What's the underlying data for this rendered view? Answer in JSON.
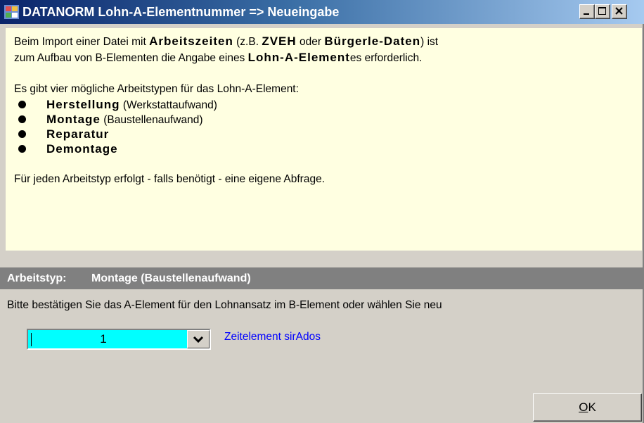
{
  "window": {
    "title": "DATANORM Lohn-A-Elementnummer => Neueingabe",
    "icon": "datanorm-app-icon",
    "controls": [
      "minimize-icon",
      "maximize-icon",
      "close-icon"
    ]
  },
  "info": {
    "para1": {
      "t1": "Beim Import einer Datei mit ",
      "b1": "Arbeitszeiten",
      "t2": " (z.B. ",
      "b2": "ZVEH",
      "t3": " oder ",
      "b3": "Bürgerle-Daten",
      "t4": ") ist",
      "t5": "zum Aufbau von B-Elementen die Angabe eines ",
      "b4": "Lohn-A-Element",
      "t6": "es erforderlich."
    },
    "para2": "Es gibt vier mögliche Arbeitstypen für das Lohn-A-Element:",
    "types": [
      {
        "name": "Herstellung",
        "desc": " (Werkstattaufwand)"
      },
      {
        "name": "Montage",
        "desc": " (Baustellenaufwand)"
      },
      {
        "name": "Reparatur",
        "desc": ""
      },
      {
        "name": "Demontage",
        "desc": ""
      }
    ],
    "para3": "Für jeden Arbeitstyp erfolgt - falls benötigt - eine eigene Abfrage."
  },
  "arbeitstyp": {
    "label": "Arbeitstyp:",
    "value": "Montage (Baustellenaufwand)"
  },
  "instruction": "Bitte bestätigen Sie das A-Element für den Lohnansatz im B-Element oder wählen Sie neu",
  "combo": {
    "value": "1"
  },
  "link": "Zeitelement sirAdos",
  "ok_button": {
    "mnemonic": "O",
    "rest": "K"
  },
  "colors": {
    "title_gradient_start": "#0a246a",
    "title_gradient_end": "#a6caf0",
    "info_background": "#ffffe1",
    "type_bar": "#808080",
    "combo_background": "#00ffff",
    "link": "#0000ff",
    "dialog_background": "#d4d0c8"
  }
}
